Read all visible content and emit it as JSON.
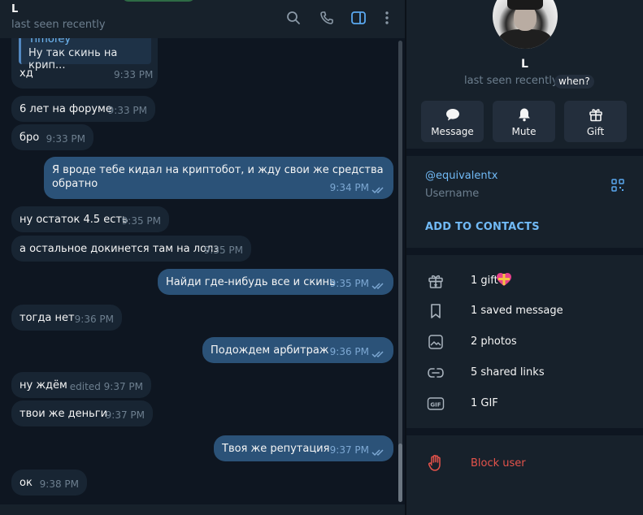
{
  "chat_header": {
    "name": "L",
    "status": "last seen recently",
    "icons": [
      "search-icon",
      "phone-icon",
      "sidebar-toggle-icon",
      "more-vert-icon"
    ]
  },
  "reply_message": {
    "author": "Timofey",
    "quote": "Ну так скинь на крип...",
    "text": "хд",
    "time": "9:33 PM"
  },
  "messages": [
    {
      "dir": "in",
      "text": "6 лет на форуме",
      "time": "9:33 PM"
    },
    {
      "dir": "in",
      "text": "бро",
      "time": "9:33 PM"
    },
    {
      "dir": "out",
      "text": "Я вроде тебе кидал на криптобот, и жду свои же средства",
      "text2": "обратно",
      "time": "9:34 PM",
      "read": true
    },
    {
      "dir": "in",
      "text": "ну остаток 4.5 есть",
      "time": "9:35 PM"
    },
    {
      "dir": "in",
      "text": "а остальное докинется там на лолз",
      "time": "9:35 PM"
    },
    {
      "dir": "out",
      "text": "Найди где-нибудь все и скинь",
      "time": "9:35 PM",
      "read": true
    },
    {
      "dir": "in",
      "text": "тогда нет",
      "time": "9:36 PM"
    },
    {
      "dir": "out",
      "text": "Подождем арбитраж",
      "time": "9:36 PM",
      "read": true
    },
    {
      "dir": "in",
      "text": "ну ждём",
      "time": "edited 9:37 PM"
    },
    {
      "dir": "in",
      "text": "твои же деньги",
      "time": "9:37 PM"
    },
    {
      "dir": "out",
      "text": "Твоя же репутация",
      "time": "9:37 PM",
      "read": true
    },
    {
      "dir": "in",
      "text": "ок",
      "time": "9:38 PM"
    }
  ],
  "profile": {
    "name": "L",
    "status": "last seen recently",
    "when_label": "when?",
    "actions": [
      {
        "label": "Message",
        "icon": "chat-bubble-icon"
      },
      {
        "label": "Mute",
        "icon": "bell-icon"
      },
      {
        "label": "Gift",
        "icon": "gift-icon"
      }
    ],
    "username": "@equivalentx",
    "username_label": "Username",
    "add_contacts": "ADD TO CONTACTS",
    "media": [
      {
        "label": "1 gift",
        "icon": "gift-icon"
      },
      {
        "label": "1 saved message",
        "icon": "bookmark-icon"
      },
      {
        "label": "2 photos",
        "icon": "photo-icon"
      },
      {
        "label": "5 shared links",
        "icon": "link-icon"
      },
      {
        "label": "1 GIF",
        "icon": "gif-icon"
      }
    ],
    "block": "Block user"
  },
  "colors": {
    "chat_bg": "#0e1621",
    "panel_bg": "#17212b",
    "incoming_bubble": "#182533",
    "outgoing_bubble": "#2b5278",
    "accent": "#71baf6",
    "danger": "#e5534b"
  }
}
